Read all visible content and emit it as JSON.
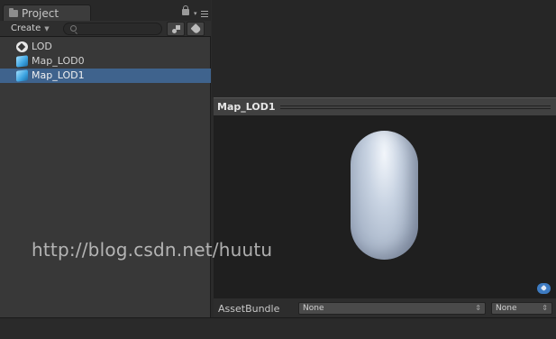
{
  "project_panel": {
    "tab_label": "Project",
    "create_label": "Create",
    "search_placeholder": "",
    "items": [
      {
        "label": "LOD",
        "icon": "unity-scene-icon",
        "selected": false
      },
      {
        "label": "Map_LOD0",
        "icon": "prefab-cube-icon",
        "selected": false
      },
      {
        "label": "Map_LOD1",
        "icon": "prefab-cube-icon",
        "selected": true
      }
    ]
  },
  "watermark": "http://blog.csdn.net/huutu",
  "preview": {
    "title": "Map_LOD1",
    "object": "capsule"
  },
  "asset_bundle": {
    "label": "AssetBundle",
    "name_value": "None",
    "variant_value": "None"
  },
  "colors": {
    "selection": "#3f638d",
    "panel_bg": "#383838",
    "preview_bg": "#1f1f1f"
  }
}
